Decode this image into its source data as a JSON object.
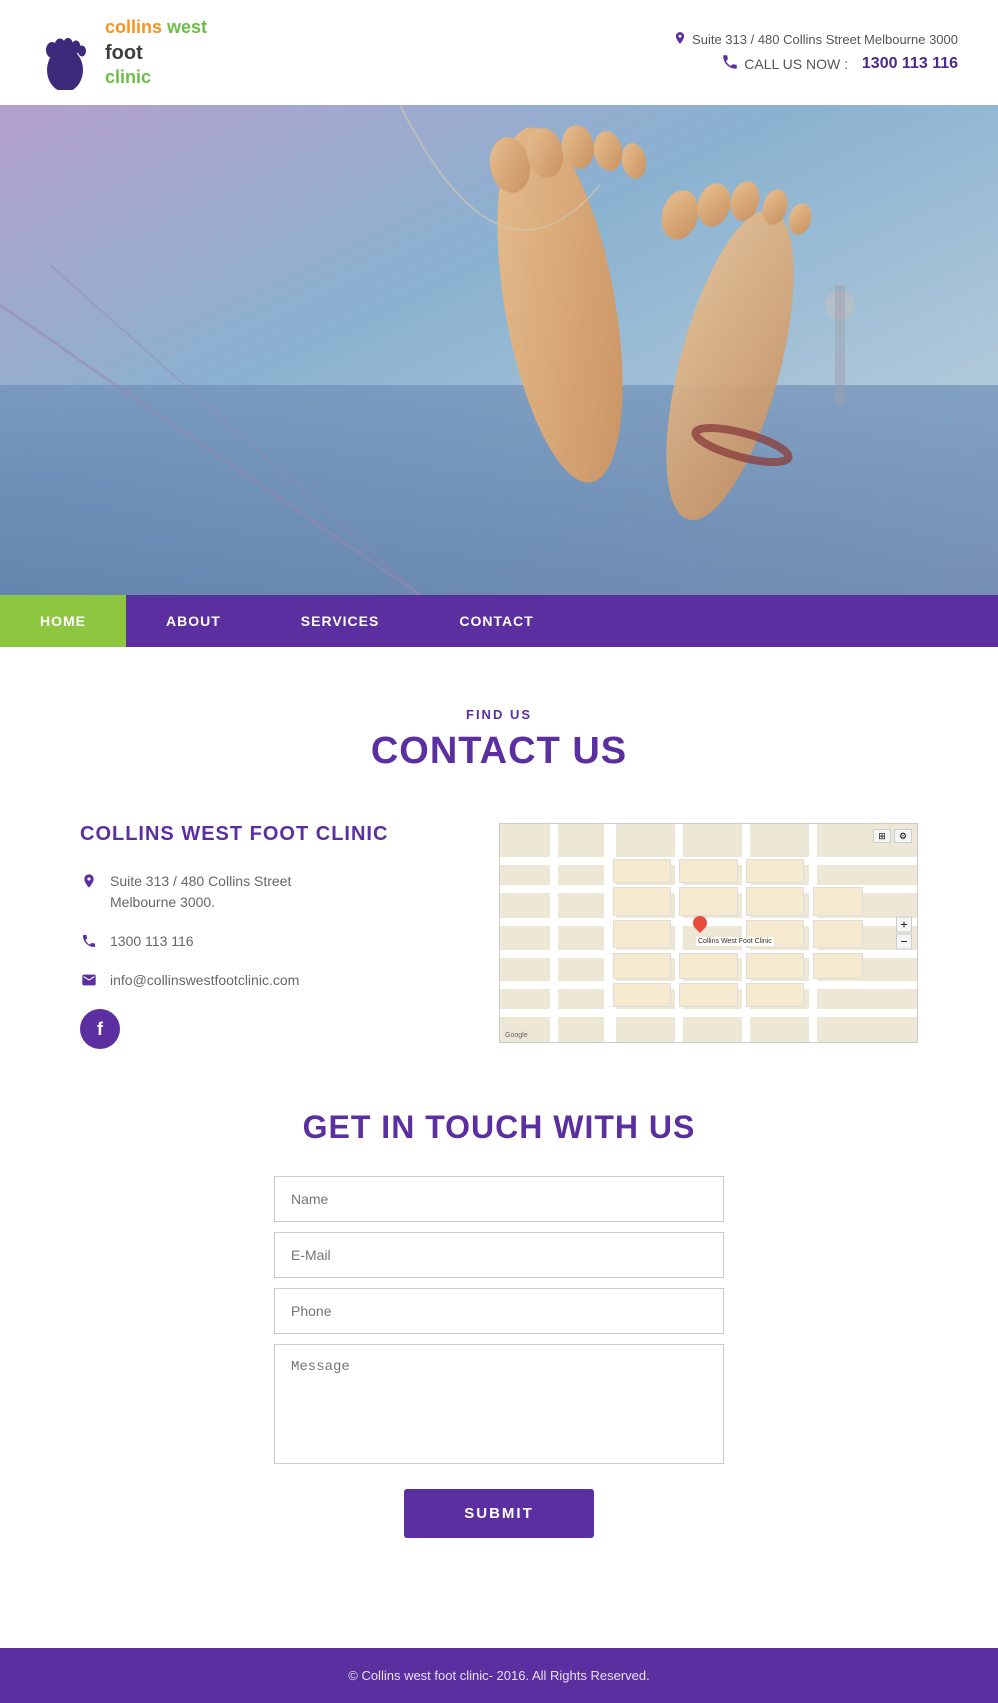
{
  "header": {
    "logo": {
      "line1_part1": "collins ",
      "line1_part2": "west",
      "line2": "foot",
      "line3": "clinic"
    },
    "address": "Suite 313 / 480 Collins Street Melbourne 3000",
    "phone_label": "CALL US NOW :",
    "phone_number": "1300 113 116"
  },
  "nav": {
    "items": [
      {
        "label": "HOME",
        "active": true
      },
      {
        "label": "ABOUT",
        "active": false
      },
      {
        "label": "SERVICES",
        "active": false
      },
      {
        "label": "CONTACT",
        "active": false
      }
    ]
  },
  "contact_section": {
    "subtitle": "FIND US",
    "title_part1": "CONTACT ",
    "title_part2": "US",
    "clinic_name": "COLLINS WEST FOOT CLINIC",
    "address_line1": "Suite 313 / 480 Collins Street",
    "address_line2": "Melbourne 3000.",
    "phone": "1300 113 116",
    "email": "info@collinswestfootclinic.com"
  },
  "touch_section": {
    "title_part1": "GET IN ",
    "title_part2": "TOUCH WITH US",
    "name_placeholder": "Name",
    "email_placeholder": "E-Mail",
    "phone_placeholder": "Phone",
    "message_placeholder": "Message",
    "submit_label": "SUBMIT"
  },
  "footer": {
    "copyright": "© Collins west foot clinic- 2016. All Rights Reserved."
  }
}
